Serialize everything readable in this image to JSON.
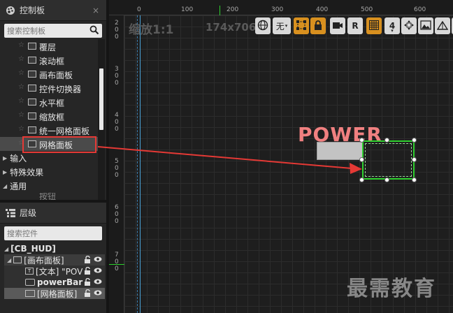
{
  "palette": {
    "title": "控制板",
    "close_label": "×",
    "search_placeholder": "搜索控制板",
    "items": [
      {
        "label": "覆层",
        "icon": "overlay-icon"
      },
      {
        "label": "滚动框",
        "icon": "scrollbox-icon"
      },
      {
        "label": "画布面板",
        "icon": "canvas-panel-icon"
      },
      {
        "label": "控件切换器",
        "icon": "widget-switcher-icon"
      },
      {
        "label": "水平框",
        "icon": "horizontal-box-icon"
      },
      {
        "label": "缩放框",
        "icon": "scale-box-icon"
      },
      {
        "label": "统一网格面板",
        "icon": "uniform-grid-icon"
      },
      {
        "label": "网格面板",
        "icon": "grid-panel-icon"
      }
    ],
    "categories": [
      {
        "label": "输入",
        "expanded": false
      },
      {
        "label": "特殊效果",
        "expanded": false
      },
      {
        "label": "通用",
        "expanded": true
      }
    ],
    "next_item_partial": "按钮"
  },
  "hierarchy": {
    "title": "层级",
    "search_placeholder": "搜索控件",
    "tree": [
      {
        "label": "[CB_HUD]",
        "level": 0,
        "expanded": true
      },
      {
        "label": "[画布面板]",
        "level": 1,
        "expanded": true
      },
      {
        "label": "[文本] \"POV",
        "level": 2
      },
      {
        "label": "powerBar",
        "level": 2
      },
      {
        "label": "[网格面板]",
        "level": 2
      }
    ]
  },
  "viewport": {
    "zoom_label": "缩放1:1",
    "size_label": "174x706",
    "ruler_x_labels": [
      "0",
      "100",
      "200",
      "300",
      "400",
      "500",
      "600"
    ],
    "ruler_y_labels": [
      "2\n0\n0",
      "3\n0\n0",
      "4\n0\n0",
      "5\n0\n0",
      "6\n0\n0",
      "7\n0\n0"
    ],
    "toolbar": {
      "none_label": "无",
      "r_label": "R",
      "step_value": "4"
    },
    "canvas_text": "POWER",
    "watermark": "最需教育"
  },
  "colors": {
    "accent_orange": "#d8901f",
    "selection_green": "#2ed02e",
    "highlight_red": "#e53935",
    "power_text": "#f08080"
  }
}
